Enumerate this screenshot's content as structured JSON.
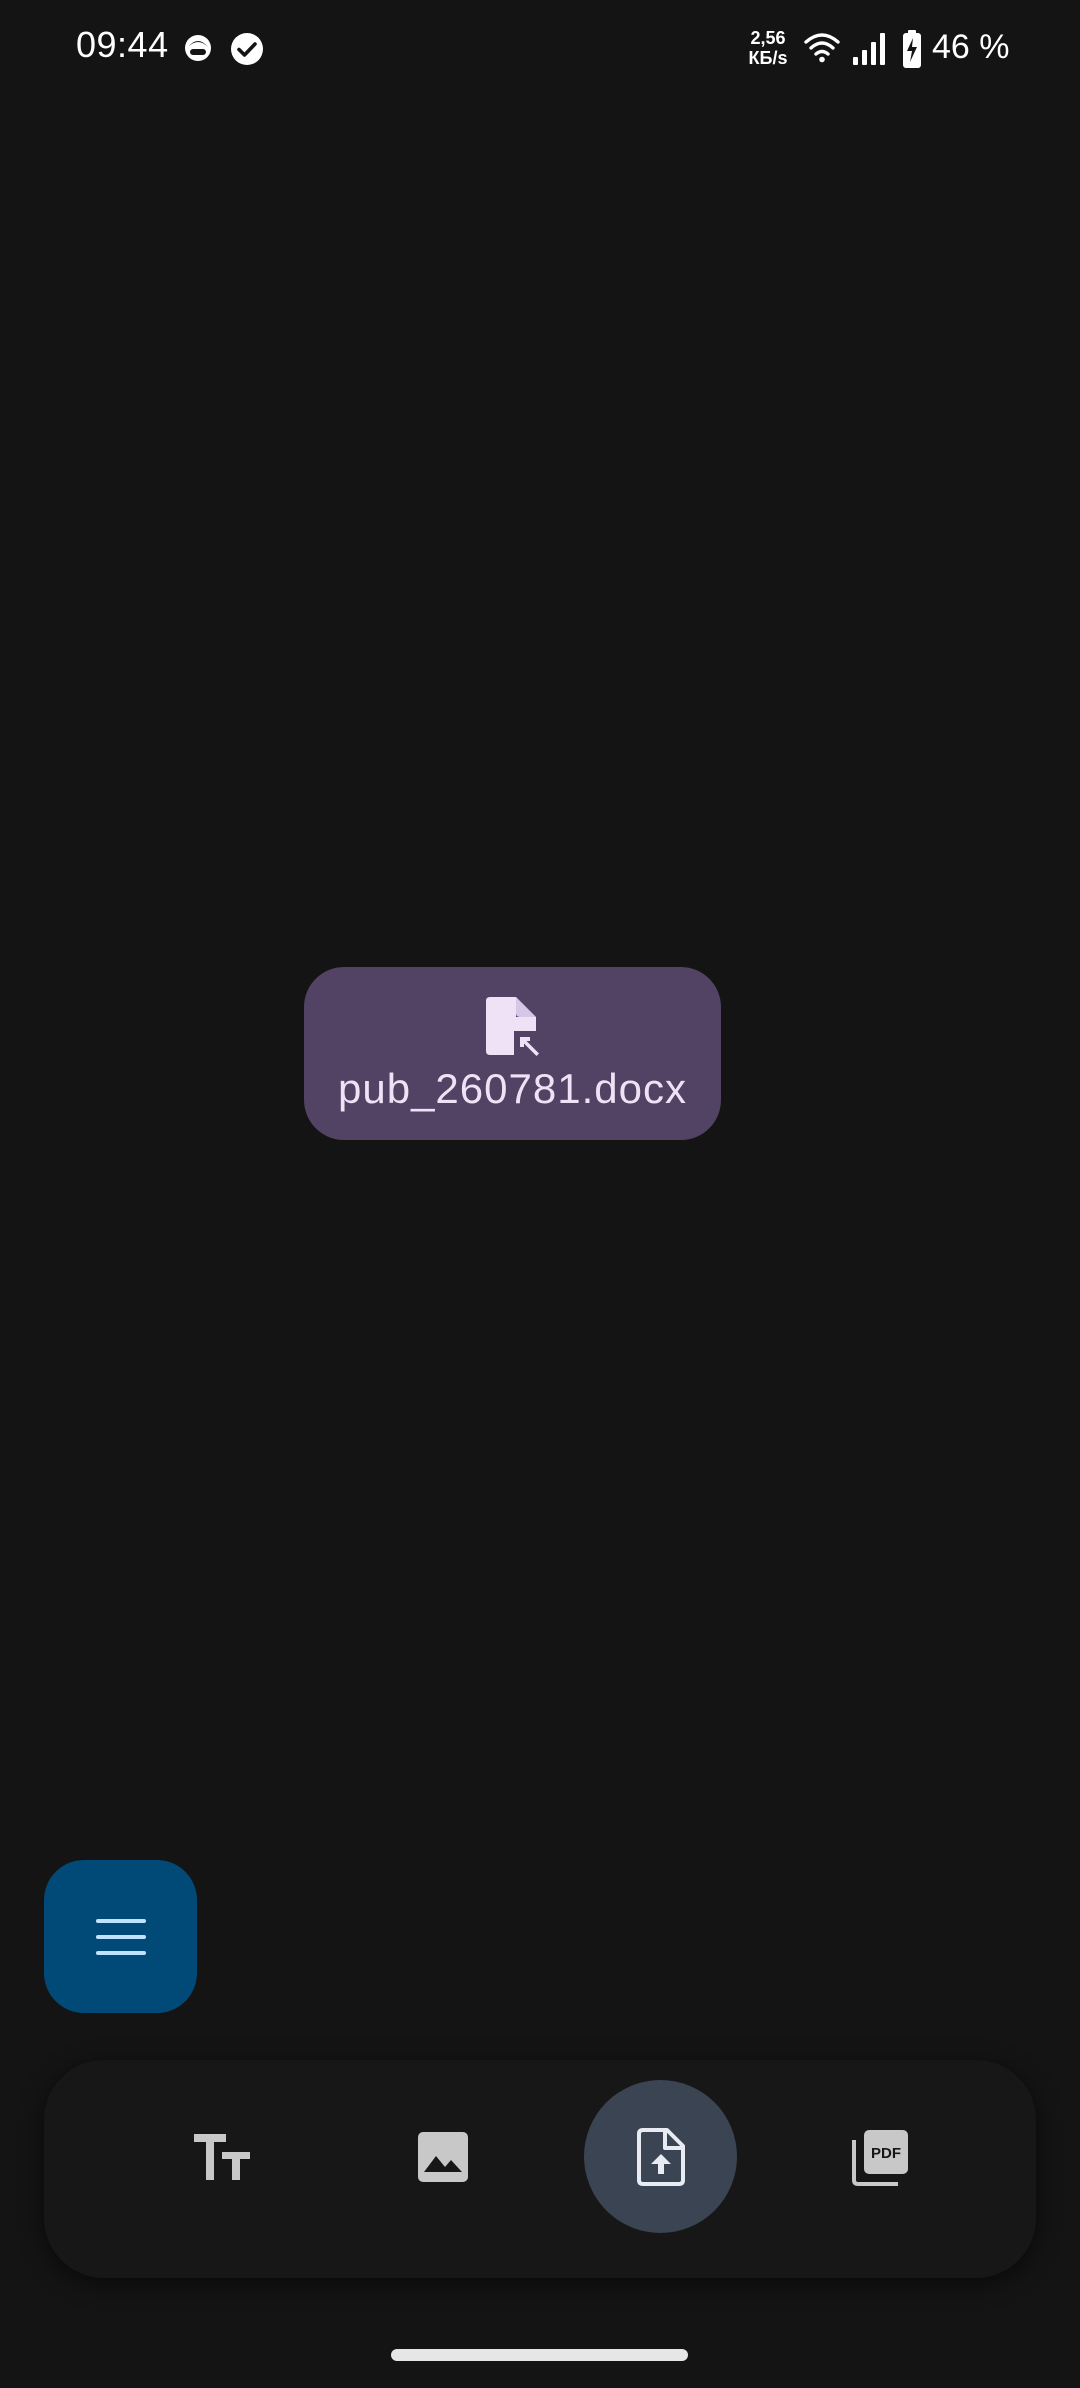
{
  "status_bar": {
    "time": "09:44",
    "network_speed_value": "2,56",
    "network_speed_unit": "КБ/s",
    "battery_percent": "46 %",
    "icons": [
      "notification-face-icon",
      "check-circle-icon",
      "wifi-icon",
      "cell-signal-icon",
      "battery-charging-icon"
    ]
  },
  "file_chip": {
    "icon": "file-shortcut-icon",
    "filename": "pub_260781.docx"
  },
  "menu_fab": {
    "icon": "menu-icon"
  },
  "bottom_nav": {
    "items": [
      {
        "id": "text",
        "icon": "text-size-icon",
        "active": false
      },
      {
        "id": "image",
        "icon": "image-icon",
        "active": false
      },
      {
        "id": "document",
        "icon": "upload-file-icon",
        "active": true
      },
      {
        "id": "pdf",
        "icon": "pdf-icon",
        "active": false
      }
    ]
  },
  "colors": {
    "background": "#141414",
    "chip_background": "#524263",
    "chip_text": "#efe2f6",
    "fab_background": "#014a77",
    "nav_active": "#3a4452",
    "nav_icon": "#c8c8c8"
  }
}
